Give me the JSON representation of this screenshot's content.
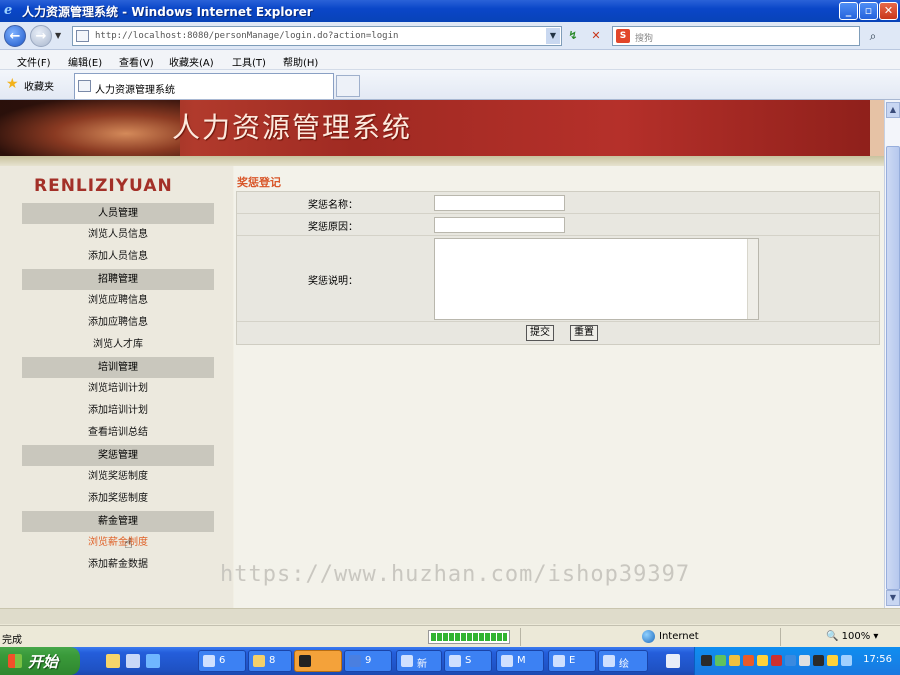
{
  "window": {
    "title": "人力资源管理系统 - Windows Internet Explorer"
  },
  "address_bar": {
    "url": "http://localhost:8080/personManage/login.do?action=login",
    "search_placeholder": "搜狗"
  },
  "menu": {
    "items": [
      "文件(F)",
      "编辑(E)",
      "查看(V)",
      "收藏夹(A)",
      "工具(T)",
      "帮助(H)"
    ]
  },
  "favorites": {
    "label": "收藏夹",
    "tab_title": "人力资源管理系统"
  },
  "banner": {
    "title": "人力资源管理系统"
  },
  "sidebar": {
    "brand": "RENLIZIYUAN",
    "sections": [
      {
        "header": "人员管理",
        "links": [
          "浏览人员信息",
          "添加人员信息"
        ]
      },
      {
        "header": "招聘管理",
        "links": [
          "浏览应聘信息",
          "添加应聘信息",
          "浏览人才库"
        ]
      },
      {
        "header": "培训管理",
        "links": [
          "浏览培训计划",
          "添加培训计划",
          "查看培训总结"
        ]
      },
      {
        "header": "奖惩管理",
        "links": [
          "浏览奖惩制度",
          "添加奖惩制度"
        ]
      },
      {
        "header": "薪金管理",
        "links": [
          "浏览薪金制度",
          "添加薪金数据"
        ]
      }
    ],
    "active_link": "浏览薪金制度"
  },
  "form": {
    "section_title": "奖惩登记",
    "fields": {
      "name_label": "奖惩名称：",
      "name_value": "",
      "reason_label": "奖惩原因：",
      "reason_value": "",
      "desc_label": "奖惩说明：",
      "desc_value": ""
    },
    "submit_label": "提交",
    "reset_label": "重置"
  },
  "watermark": "https://www.huzhan.com/ishop39397",
  "status": {
    "text": "完成",
    "zone": "Internet",
    "zoom": "100%",
    "progress": 1.0
  },
  "taskbar": {
    "start_label": "开始",
    "tasks": [
      "6",
      "8",
      "",
      "9",
      "新",
      "S",
      "M",
      "E",
      "绘"
    ],
    "clock": "17:56"
  },
  "colors": {
    "accent_orange": "#d9572a",
    "titlebar_blue": "#0a46c8",
    "banner_red": "#b13a2c"
  }
}
